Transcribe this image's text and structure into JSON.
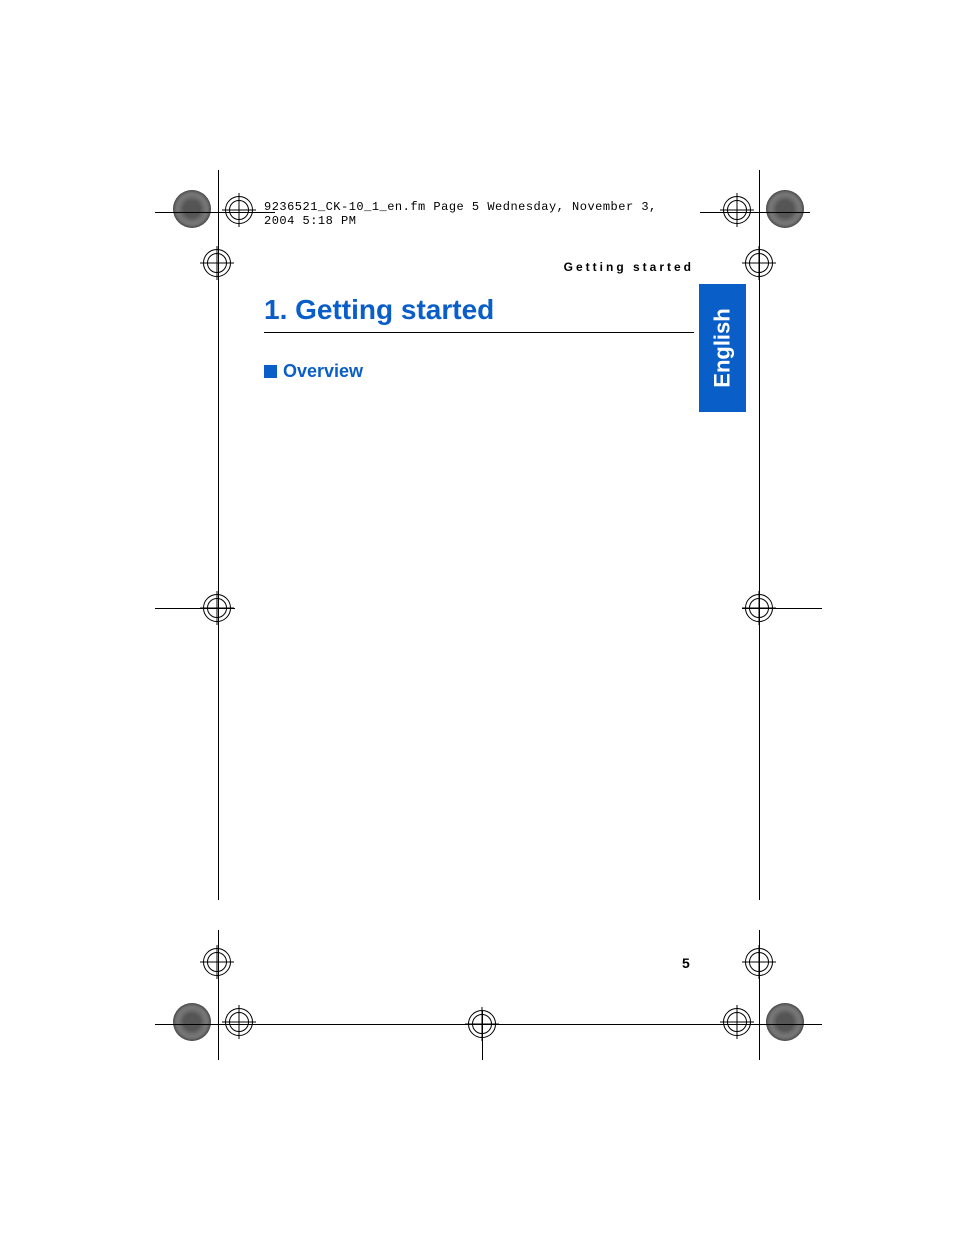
{
  "meta_line": "9236521_CK-10_1_en.fm  Page 5  Wednesday, November 3, 2004  5:18 PM",
  "running_head": "Getting started",
  "chapter_title": "1. Getting started",
  "section_title": "Overview",
  "language_tab": "English",
  "page_number": "5"
}
